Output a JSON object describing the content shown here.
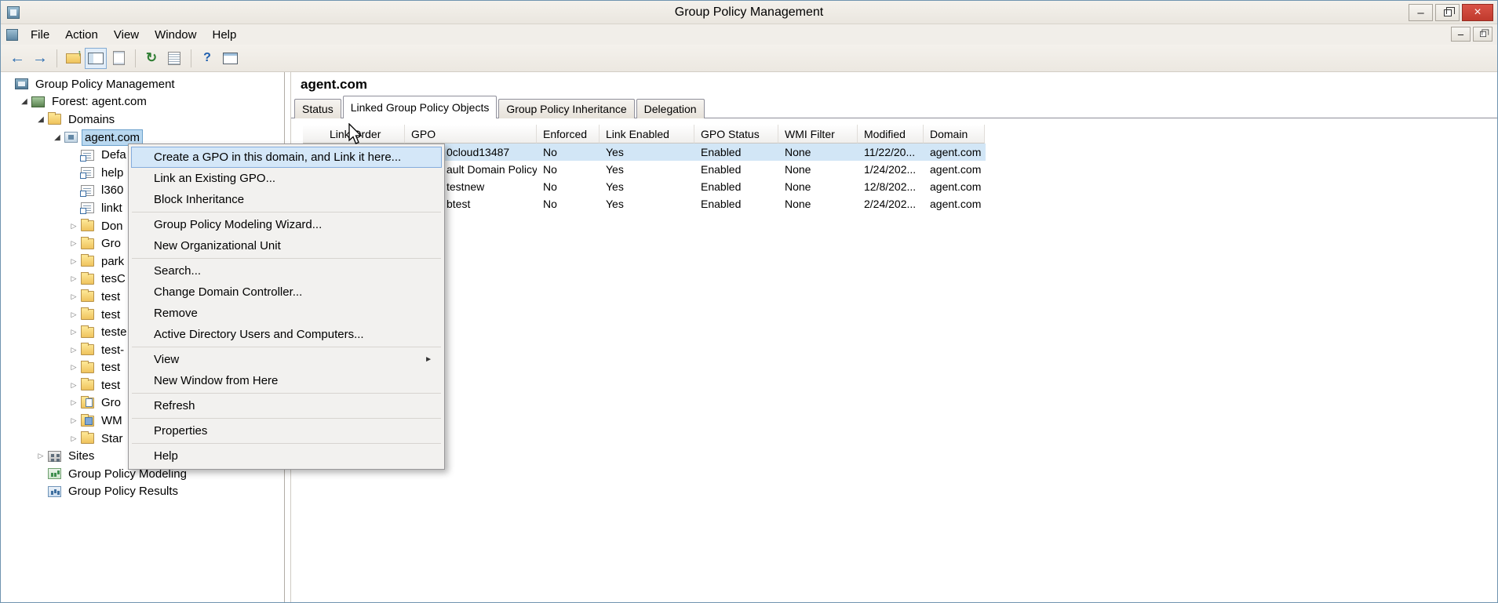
{
  "window": {
    "title": "Group Policy Management",
    "controls": {
      "minimize_glyph": "–",
      "close_glyph": "×"
    }
  },
  "icons": {
    "back": "←",
    "forward": "→",
    "help": "?",
    "refresh": "↻",
    "submenu_arrow": "►",
    "expanded": "◢",
    "collapsed": "▷"
  },
  "menubar": {
    "items": [
      "File",
      "Action",
      "View",
      "Window",
      "Help"
    ]
  },
  "toolbar": {
    "icons": [
      {
        "name": "back-icon",
        "glyph": "back"
      },
      {
        "name": "forward-icon",
        "glyph": "forward"
      },
      {
        "sep": true
      },
      {
        "name": "up-one-level-icon"
      },
      {
        "name": "show-console-tree-icon",
        "pressed": true
      },
      {
        "name": "properties-icon"
      },
      {
        "sep": true
      },
      {
        "name": "refresh-icon",
        "glyph": "refresh"
      },
      {
        "name": "export-list-icon"
      },
      {
        "sep": true
      },
      {
        "name": "help-icon",
        "glyph": "help"
      },
      {
        "name": "new-window-icon"
      }
    ]
  },
  "tree": {
    "items": [
      {
        "label": "Group Policy Management",
        "level": 0,
        "icon": "console-icon",
        "expanded": null
      },
      {
        "label": "Forest: agent.com",
        "level": 1,
        "icon": "forest-icon",
        "expanded": true
      },
      {
        "label": "Domains",
        "level": 2,
        "icon": "domains-icon",
        "expanded": true
      },
      {
        "label": "agent.com",
        "level": 3,
        "icon": "domain-icon",
        "expanded": true,
        "selected": true
      },
      {
        "label": "Defa",
        "level": 4,
        "icon": "gpo-link-icon",
        "expanded": null
      },
      {
        "label": "help",
        "level": 4,
        "icon": "gpo-link-icon",
        "expanded": null
      },
      {
        "label": "l360",
        "level": 4,
        "icon": "gpo-link-icon",
        "expanded": null
      },
      {
        "label": "linkt",
        "level": 4,
        "icon": "gpo-link-icon",
        "expanded": null
      },
      {
        "label": "Don",
        "level": 4,
        "icon": "ou-folder-icon",
        "expanded": false
      },
      {
        "label": "Gro",
        "level": 4,
        "icon": "ou-folder-icon",
        "expanded": false
      },
      {
        "label": "park",
        "level": 4,
        "icon": "ou-folder-icon",
        "expanded": false
      },
      {
        "label": "tesC",
        "level": 4,
        "icon": "ou-folder-icon",
        "expanded": false
      },
      {
        "label": "test",
        "level": 4,
        "icon": "ou-folder-icon",
        "expanded": false
      },
      {
        "label": "test",
        "level": 4,
        "icon": "ou-folder-icon",
        "expanded": false
      },
      {
        "label": "teste",
        "level": 4,
        "icon": "ou-folder-icon",
        "expanded": false
      },
      {
        "label": "test-",
        "level": 4,
        "icon": "ou-folder-icon",
        "expanded": false
      },
      {
        "label": "test",
        "level": 4,
        "icon": "ou-folder-icon",
        "expanded": false
      },
      {
        "label": "test",
        "level": 4,
        "icon": "ou-folder-icon",
        "expanded": false
      },
      {
        "label": "Gro",
        "level": 4,
        "icon": "gpo-objects-icon",
        "expanded": false
      },
      {
        "label": "WM",
        "level": 4,
        "icon": "wmi-filters-icon",
        "expanded": false
      },
      {
        "label": "Star",
        "level": 4,
        "icon": "starter-gpo-icon",
        "expanded": false
      },
      {
        "label": "Sites",
        "level": 2,
        "icon": "sites-icon",
        "expanded": false
      },
      {
        "label": "Group Policy Modeling",
        "level": 2,
        "icon": "modeling-icon",
        "expanded": null
      },
      {
        "label": "Group Policy Results",
        "level": 2,
        "icon": "results-icon",
        "expanded": null
      }
    ]
  },
  "context_menu": {
    "items": [
      {
        "label": "Create a GPO in this domain, and Link it here...",
        "highlighted": true
      },
      {
        "label": "Link an Existing GPO..."
      },
      {
        "label": "Block Inheritance"
      },
      {
        "separator": true
      },
      {
        "label": "Group Policy Modeling Wizard..."
      },
      {
        "label": "New Organizational Unit"
      },
      {
        "separator": true
      },
      {
        "label": "Search..."
      },
      {
        "label": "Change Domain Controller..."
      },
      {
        "label": "Remove"
      },
      {
        "label": "Active Directory Users and Computers..."
      },
      {
        "separator": true
      },
      {
        "label": "View",
        "submenu": true
      },
      {
        "label": "New Window from Here"
      },
      {
        "separator": true
      },
      {
        "label": "Refresh"
      },
      {
        "separator": true
      },
      {
        "label": "Properties"
      },
      {
        "separator": true
      },
      {
        "label": "Help"
      }
    ]
  },
  "main": {
    "header": "agent.com",
    "tabs": [
      {
        "label": "Status"
      },
      {
        "label": "Linked Group Policy Objects",
        "active": true
      },
      {
        "label": "Group Policy Inheritance"
      },
      {
        "label": "Delegation"
      }
    ],
    "table": {
      "columns": [
        "Link Order",
        "GPO",
        "Enforced",
        "Link Enabled",
        "GPO Status",
        "WMI Filter",
        "Modified",
        "Domain"
      ],
      "rows": [
        {
          "cells": [
            "",
            "0cloud13487",
            "No",
            "Yes",
            "Enabled",
            "None",
            "11/22/20...",
            "agent.com"
          ],
          "selected": true
        },
        {
          "cells": [
            "",
            "ault Domain Policy",
            "No",
            "Yes",
            "Enabled",
            "None",
            "1/24/202...",
            "agent.com"
          ]
        },
        {
          "cells": [
            "",
            "testnew",
            "No",
            "Yes",
            "Enabled",
            "None",
            "12/8/202...",
            "agent.com"
          ]
        },
        {
          "cells": [
            "",
            "btest",
            "No",
            "Yes",
            "Enabled",
            "None",
            "2/24/202...",
            "agent.com"
          ]
        }
      ]
    }
  }
}
